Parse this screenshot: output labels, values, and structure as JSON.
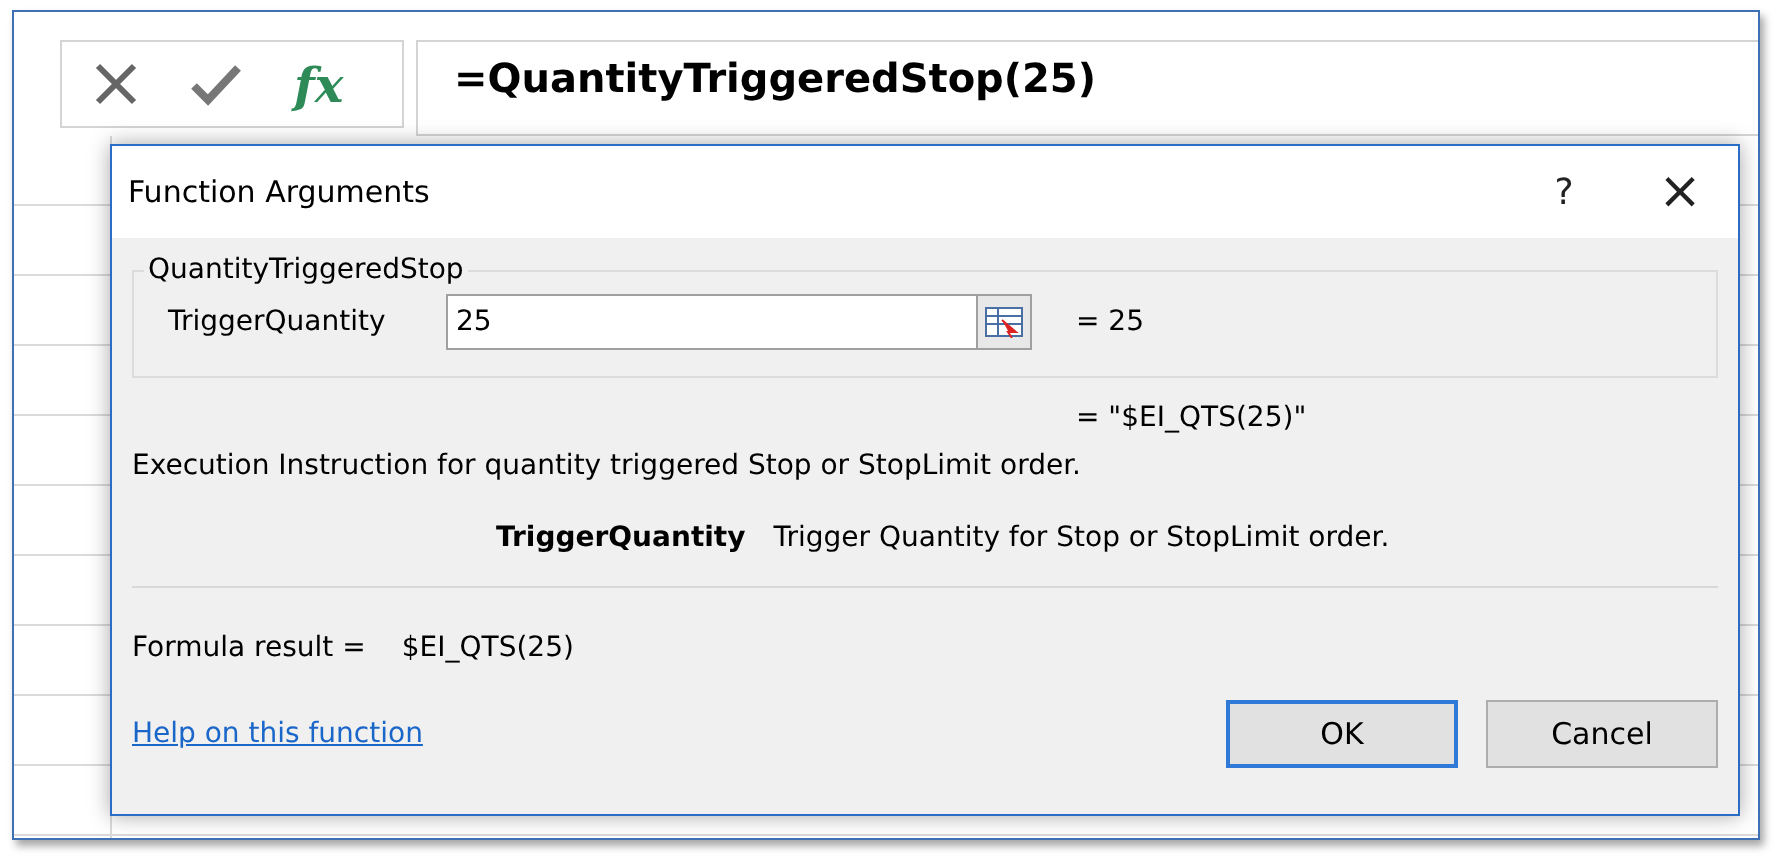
{
  "formula_bar": {
    "function_label": "fx",
    "formula": "=QuantityTriggeredStop(25)"
  },
  "dialog": {
    "title": "Function Arguments",
    "help_glyph": "?",
    "close_glyph": "×",
    "group": {
      "title": "QuantityTriggeredStop",
      "arguments": [
        {
          "name": "TriggerQuantity",
          "value": "25",
          "result": "= 25"
        }
      ]
    },
    "function_result": "= \"$EI_QTS(25)\"",
    "description": "Execution Instruction for quantity triggered Stop or StopLimit order.",
    "argument_help": {
      "name": "TriggerQuantity",
      "text": "Trigger Quantity for Stop or StopLimit order."
    },
    "formula_result": {
      "label": "Formula result =",
      "value": "$EI_QTS(25)"
    },
    "help_link": "Help on this function",
    "buttons": [
      {
        "label": "OK",
        "default": true
      },
      {
        "label": "Cancel",
        "default": false
      }
    ]
  }
}
